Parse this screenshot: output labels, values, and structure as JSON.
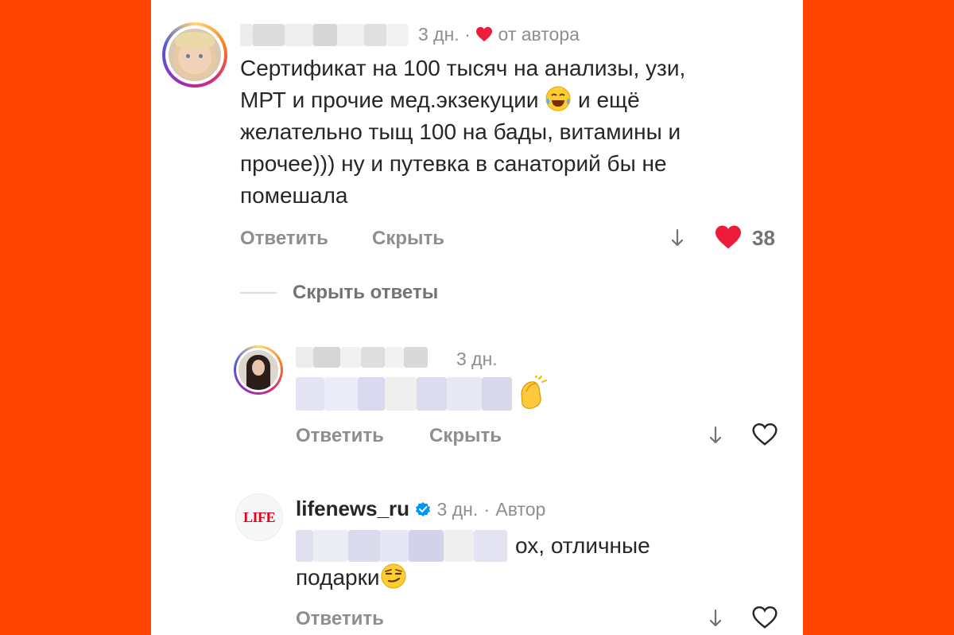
{
  "comment1": {
    "time": "3 дн.",
    "dot": "·",
    "liked_by_author": "от автора",
    "lines": [
      "Сертификат на 100 тысяч на анализы, узи,",
      "МРТ и прочие мед.экзекуции",
      "и ещё",
      "желательно тыщ 100 на бады, витамины и",
      "прочее))) ну и путевка в санаторий бы не",
      "помешала"
    ],
    "reply_label": "Ответить",
    "hide_label": "Скрыть",
    "likes": "38",
    "emoji_icon": "laughing-crying-emoji-icon"
  },
  "toggle": {
    "hide_replies_label": "Скрыть ответы"
  },
  "reply1": {
    "time": "3 дн.",
    "reply_label": "Ответить",
    "hide_label": "Скрыть",
    "emoji_icon": "clapping-hands-emoji-icon"
  },
  "reply2": {
    "username": "lifenews_ru",
    "time": "3 дн.",
    "dot": "·",
    "author_label": "Автор",
    "text_line1": "ох, отличные",
    "text_line2": "подарки",
    "avatar_text": "LIFE",
    "reply_label": "Ответить",
    "emoji_icon": "smirking-face-emoji-icon"
  },
  "colors": {
    "background": "#ff4400",
    "like_red": "#ed1c3a",
    "verified_blue": "#0095f6",
    "muted_text": "#8e8e8e",
    "life_red": "#e3001b"
  }
}
